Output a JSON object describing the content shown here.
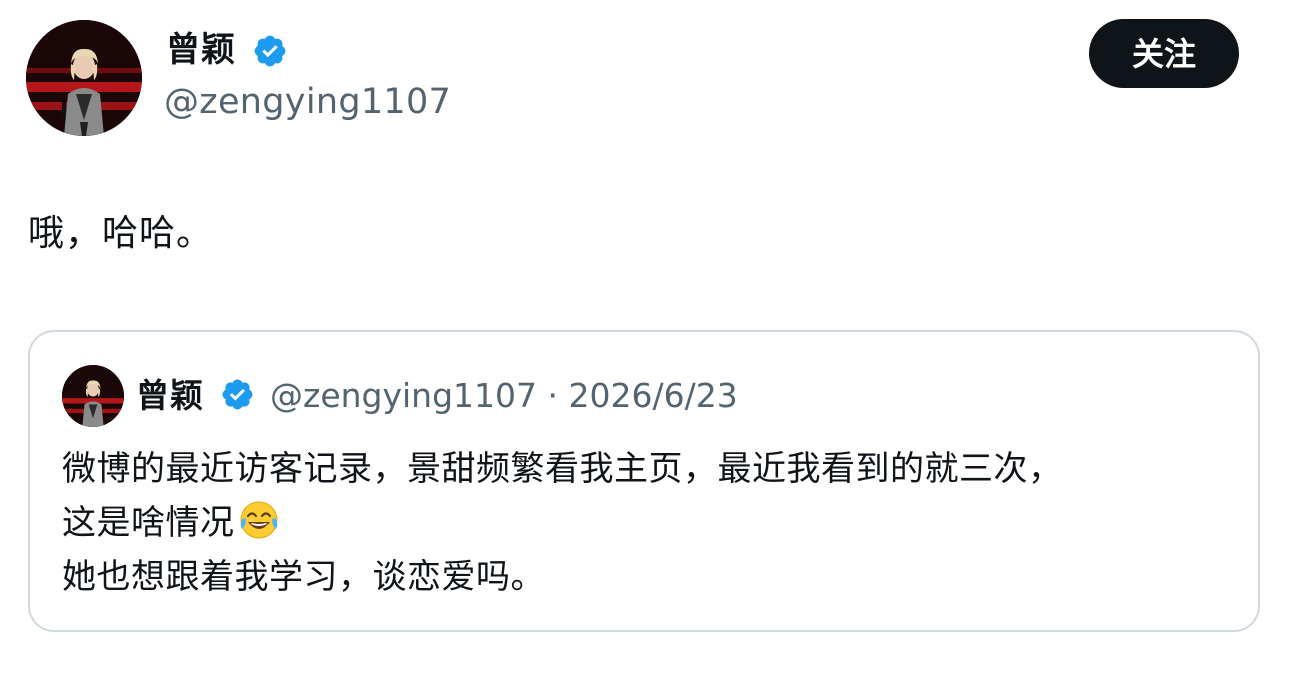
{
  "tweet": {
    "author": {
      "name": "曾颖",
      "handle": "@zengying1107",
      "verified": true,
      "verified_icon": "verified-badge-icon",
      "avatar_icon": "avatar"
    },
    "follow_label": "关注",
    "text": "哦，哈哈。"
  },
  "quote": {
    "author": {
      "name": "曾颖",
      "handle": "@zengying1107",
      "verified": true
    },
    "separator": "·",
    "date": "2026/6/23",
    "lines": [
      "微博的最近访客记录，景甜频繁看我主页，最近我看到的就三次，",
      "这是啥情况",
      "她也想跟着我学习，谈恋爱吗。"
    ],
    "emoji": "face-with-tears-of-joy-icon"
  },
  "colors": {
    "text": "#0f1419",
    "secondary": "#536471",
    "verified": "#1d9bf0",
    "button_bg": "#0f1419",
    "border": "#cfd9de"
  }
}
